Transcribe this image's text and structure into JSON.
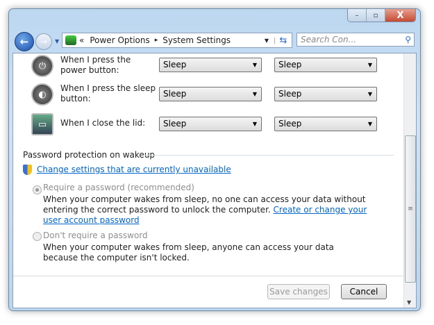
{
  "window": {
    "minimize": "–",
    "maximize": "▫",
    "close": "X"
  },
  "nav": {
    "back": "←",
    "forward": "→",
    "history": "▼"
  },
  "address": {
    "chevrons": "«",
    "crumbs": [
      "Power Options",
      "System Settings"
    ],
    "separator": "▸",
    "dropdown": "▼",
    "refresh": "⇆"
  },
  "search": {
    "placeholder": "Search Con...",
    "icon": "⚲"
  },
  "rows": [
    {
      "label": "When I press the power button:",
      "icon": "power-button-icon",
      "on_battery": "Sleep",
      "plugged_in": "Sleep"
    },
    {
      "label": "When I press the sleep button:",
      "icon": "sleep-button-icon",
      "on_battery": "Sleep",
      "plugged_in": "Sleep"
    },
    {
      "label": "When I close the lid:",
      "icon": "laptop-lid-icon",
      "on_battery": "Sleep",
      "plugged_in": "Sleep"
    }
  ],
  "password": {
    "heading": "Password protection on wakeup",
    "change_link": "Change settings that are currently unavailable",
    "require": {
      "label": "Require a password (recommended)",
      "desc": "When your computer wakes from sleep, no one can access your data without entering the correct password to unlock the computer.",
      "link": "Create or change your user account password",
      "selected": true
    },
    "dont_require": {
      "label": "Don't require a password",
      "desc": "When your computer wakes from sleep, anyone can access your data because the computer isn't locked.",
      "selected": false
    }
  },
  "buttons": {
    "save": "Save changes",
    "cancel": "Cancel"
  }
}
